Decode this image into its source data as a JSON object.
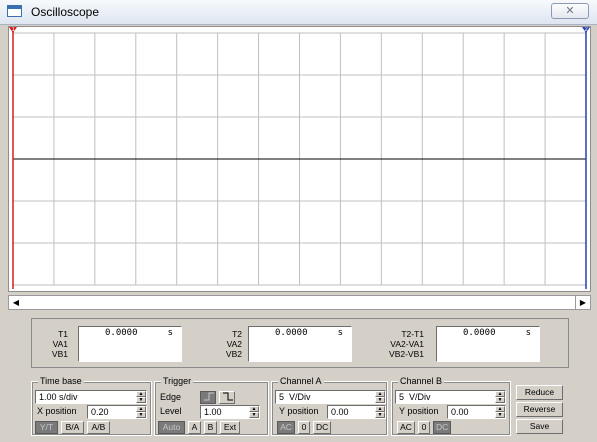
{
  "window": {
    "title": "Oscilloscope",
    "close_glyph": "✕"
  },
  "screen": {
    "background": "#ffffff",
    "grid_color": "#bfbfbf",
    "trace_color": "#000000",
    "cursor1_color": "#d42020",
    "cursor2_color": "#2a3fb8",
    "cursor1_label": "1",
    "cursor2_label": "2"
  },
  "scrollbar": {
    "left_arrow": "◀",
    "right_arrow": "▶"
  },
  "readout": {
    "col1": {
      "labels": [
        "T1",
        "VA1",
        "VB1"
      ],
      "value": "0.0000",
      "unit": "s"
    },
    "col2": {
      "labels": [
        "T2",
        "VA2",
        "VB2"
      ],
      "value": "0.0000",
      "unit": "s"
    },
    "col3": {
      "labels": [
        "T2-T1",
        "VA2-VA1",
        "VB2-VB1"
      ],
      "value": "0.0000",
      "unit": "s"
    }
  },
  "timebase": {
    "title": "Time base",
    "scale": "1.00 s/div",
    "xpos_label": "X position",
    "xpos_value": "0.20",
    "modes": [
      "Y/T",
      "B/A",
      "A/B"
    ],
    "active_mode": "Y/T"
  },
  "trigger": {
    "title": "Trigger",
    "edge_label": "Edge",
    "level_label": "Level",
    "level_value": "1.00",
    "sources": [
      "Auto",
      "A",
      "B",
      "Ext"
    ],
    "active_source": "Auto",
    "rising_icon": "rising-edge-icon",
    "falling_icon": "falling-edge-icon"
  },
  "channel_a": {
    "title": "Channel A",
    "scale": "5  V/Div",
    "ypos_label": "Y position",
    "ypos_value": "0.00",
    "coupling": [
      "AC",
      "0",
      "DC"
    ],
    "active_coupling": "AC"
  },
  "channel_b": {
    "title": "Channel B",
    "scale": "5  V/Div",
    "ypos_label": "Y position",
    "ypos_value": "0.00",
    "coupling": [
      "AC",
      "0",
      "DC"
    ],
    "active_coupling": "DC"
  },
  "actions": {
    "reduce": "Reduce",
    "reverse": "Reverse",
    "save": "Save"
  }
}
